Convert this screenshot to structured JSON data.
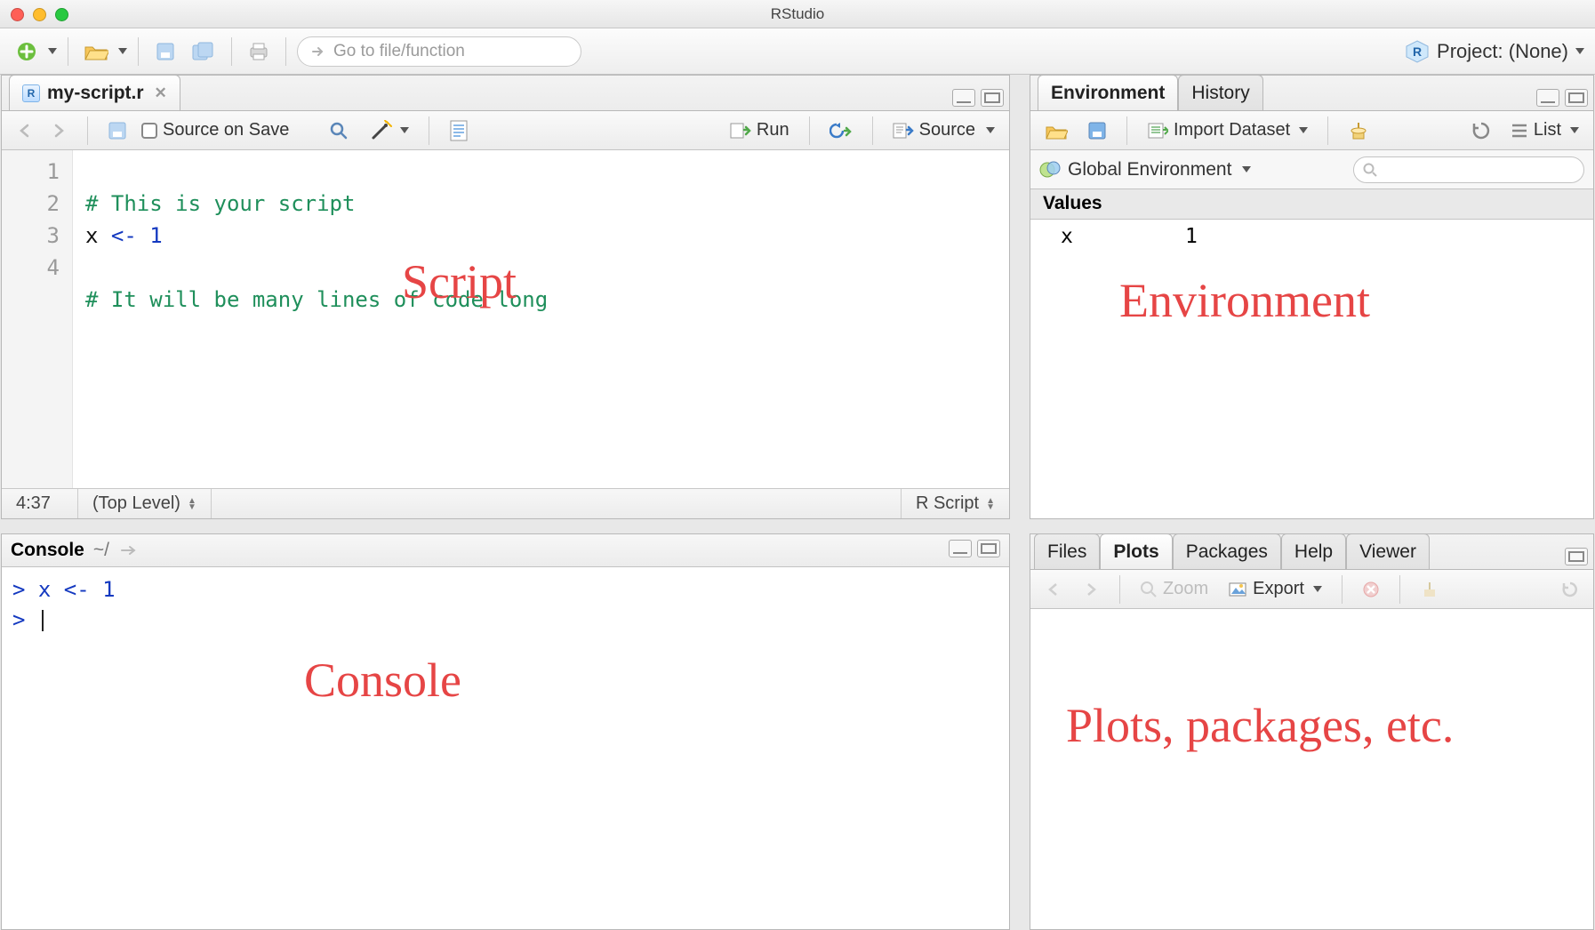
{
  "title": "RStudio",
  "toolbar": {
    "goto_placeholder": "Go to file/function",
    "project_label": "Project: (None)"
  },
  "script": {
    "tab_name": "my-script.r",
    "source_on_save": "Source on Save",
    "run_label": "Run",
    "source_label": "Source",
    "lines": {
      "n1": "1",
      "n2": "2",
      "n3": "3",
      "n4": "4",
      "l1": "# This is your script",
      "l2a": "x ",
      "l2b": "<-",
      "l2c": " 1",
      "l4": "# It will be many lines of code long"
    },
    "status_pos": "4:37",
    "status_scope": "(Top Level)",
    "status_type": "R Script",
    "overlay": "Script"
  },
  "console": {
    "header": "Console",
    "path": "~/",
    "line1": "x <- 1",
    "overlay": "Console"
  },
  "env": {
    "tab_env": "Environment",
    "tab_history": "History",
    "import_label": "Import Dataset",
    "list_label": "List",
    "scope_label": "Global Environment",
    "section": "Values",
    "row_key": "x",
    "row_val": "1",
    "overlay": "Environment"
  },
  "plots": {
    "tab_files": "Files",
    "tab_plots": "Plots",
    "tab_packages": "Packages",
    "tab_help": "Help",
    "tab_viewer": "Viewer",
    "zoom_label": "Zoom",
    "export_label": "Export",
    "overlay": "Plots, packages, etc."
  }
}
